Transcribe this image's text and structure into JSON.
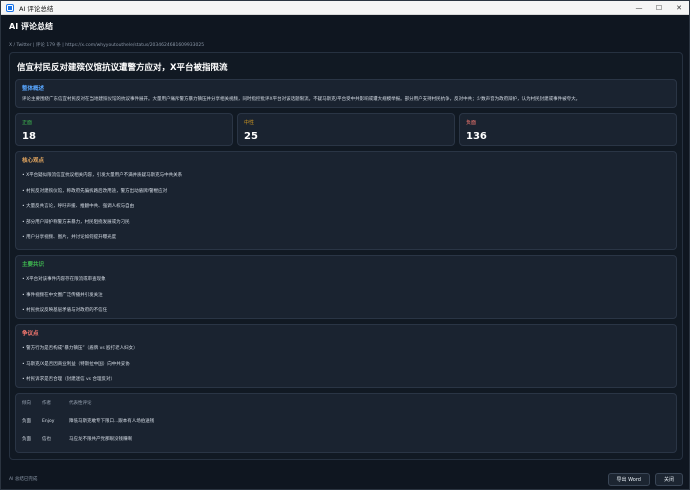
{
  "window": {
    "title": "AI 评论总结",
    "minimize": "—",
    "maximize": "☐",
    "close": "✕"
  },
  "header": {
    "title": "AI 评论总结",
    "subtitle": "X / Twitter | 评论 179 条 | https://x.com/whyyoutouthele/status/2034624681609933025"
  },
  "article_title": "信宜村民反对建殡仪馆抗议遭警方应对，X平台被指限流",
  "overview": {
    "title": "整体概述",
    "text": "评论主要围绕广东信宜村民反对在当地建殡仪馆的抗议事件展开。大量用户痛斥警方暴力镇压并分享相关视频，同时指控批评X平台对该话题限流。不疑马斯克/平台受中共影响或遭大规模举报。部分用户支持村民抗争，反对中共；少数声音为政府辩护，认为村民封建或事件被夸大。"
  },
  "stats": [
    {
      "label": "正面",
      "value": "18"
    },
    {
      "label": "中性",
      "value": "25"
    },
    {
      "label": "负面",
      "value": "136"
    }
  ],
  "core_points": {
    "title": "核心观点",
    "items": [
      "X平台疑似限流信宜抗议相关内容，引发大量用户不满并质疑马斯克与中共关系",
      "村民反对建殡仪馆，称政府先骗拆路后改用途，警方出动盾牌/警棍应对",
      "大量反共言论，呼吁声援、推翻中共、强调人权与自由",
      "部分用户辩护称警方未暴力，村民阻挠发展或为刁民",
      "用户分享视频、图片，并讨论如何提升曝光度"
    ]
  },
  "consensus": {
    "title": "主要共识",
    "items": [
      "X平台对该事件内容存在限流或审查现象",
      "事件视频在中文圈广泛传播并引发关注",
      "村民抗议反映基层矛盾与对政府的不信任"
    ]
  },
  "disputes": {
    "title": "争议点",
    "items": [
      "警方行为是否构成“暴力镇压”（盾牌 vs 殴打老人妇女）",
      "马斯克/X是否因商业利益（特斯拉中国）向中共妥协",
      "村民诉求是否合理（封建迷信 vs 合理反对）"
    ]
  },
  "comments_table": {
    "headers": [
      "倾向",
      "作者",
      "代表性评论"
    ],
    "rows": [
      {
        "sentiment": "负面",
        "author": "Enjoy",
        "comment": "障低马斯克敢专下限口...跟本有人场伯送钱"
      },
      {
        "sentiment": "负面",
        "author": "信也",
        "comment": "马应龙不限共产党那眼没钱赚啊"
      }
    ]
  },
  "footer": {
    "status": "AI 总结已完成",
    "export_label": "导出 Word",
    "close_label": "关闭"
  }
}
